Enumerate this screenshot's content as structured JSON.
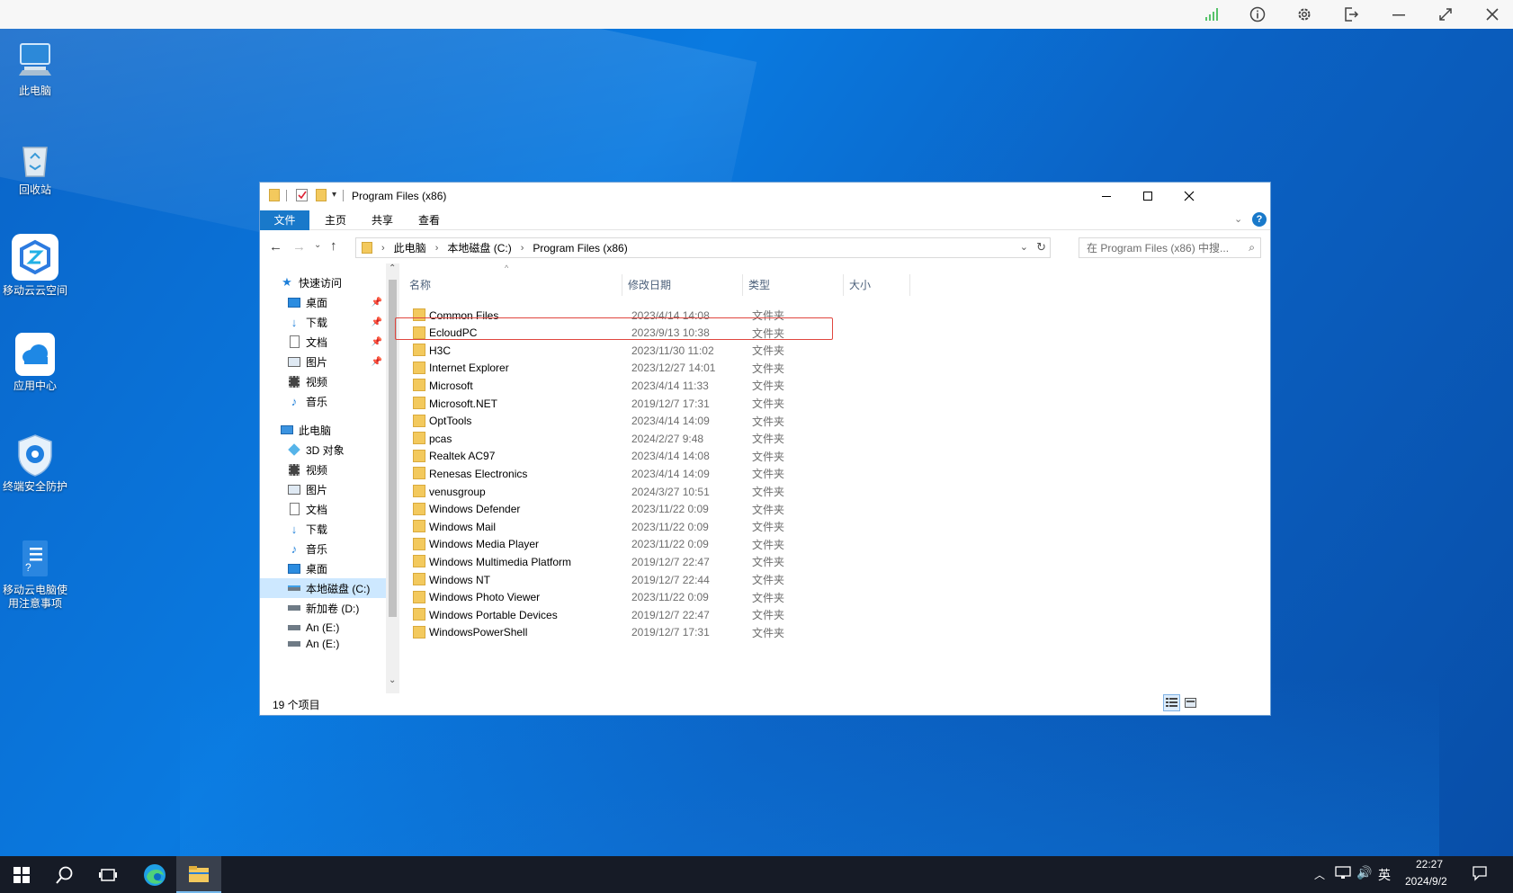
{
  "client_bar": {
    "icons": [
      "signal-icon",
      "info-icon",
      "settings-icon",
      "logout-icon",
      "minimize-icon",
      "fullscreen-icon",
      "close-icon"
    ]
  },
  "desktop": {
    "icons": [
      {
        "label": "此电脑",
        "icon": "computer-icon"
      },
      {
        "label": "回收站",
        "icon": "recycle-bin-icon"
      },
      {
        "label": "移动云云空间",
        "icon": "cloud-space-icon"
      },
      {
        "label": "应用中心",
        "icon": "app-center-icon"
      },
      {
        "label": "终端安全防护",
        "icon": "security-icon"
      },
      {
        "label": "移动云电脑使用注意事项",
        "icon": "document-icon"
      }
    ]
  },
  "window": {
    "title": "Program Files (x86)",
    "tabs": [
      "文件",
      "主页",
      "共享",
      "查看"
    ],
    "active_tab": "文件",
    "breadcrumb": [
      "此电脑",
      "本地磁盘 (C:)",
      "Program Files (x86)"
    ],
    "search_placeholder": "在 Program Files (x86) 中搜...",
    "nav": {
      "quick_access": "快速访问",
      "quick_items": [
        "桌面",
        "下载",
        "文档",
        "图片",
        "视频",
        "音乐"
      ],
      "this_pc": "此电脑",
      "pc_items": [
        "3D 对象",
        "视频",
        "图片",
        "文档",
        "下载",
        "音乐",
        "桌面",
        "本地磁盘 (C:)",
        "新加卷 (D:)",
        "An (E:)",
        "An (E:)"
      ]
    },
    "columns": [
      "名称",
      "修改日期",
      "类型",
      "大小"
    ],
    "files": [
      {
        "name": "Common Files",
        "date": "2023/4/14 14:08",
        "type": "文件夹"
      },
      {
        "name": "EcloudPC",
        "date": "2023/9/13 10:38",
        "type": "文件夹"
      },
      {
        "name": "H3C",
        "date": "2023/11/30 11:02",
        "type": "文件夹"
      },
      {
        "name": "Internet Explorer",
        "date": "2023/12/27 14:01",
        "type": "文件夹"
      },
      {
        "name": "Microsoft",
        "date": "2023/4/14 11:33",
        "type": "文件夹"
      },
      {
        "name": "Microsoft.NET",
        "date": "2019/12/7 17:31",
        "type": "文件夹"
      },
      {
        "name": "OptTools",
        "date": "2023/4/14 14:09",
        "type": "文件夹"
      },
      {
        "name": "pcas",
        "date": "2024/2/27 9:48",
        "type": "文件夹"
      },
      {
        "name": "Realtek AC97",
        "date": "2023/4/14 14:08",
        "type": "文件夹"
      },
      {
        "name": "Renesas Electronics",
        "date": "2023/4/14 14:09",
        "type": "文件夹"
      },
      {
        "name": "venusgroup",
        "date": "2024/3/27 10:51",
        "type": "文件夹"
      },
      {
        "name": "Windows Defender",
        "date": "2023/11/22 0:09",
        "type": "文件夹"
      },
      {
        "name": "Windows Mail",
        "date": "2023/11/22 0:09",
        "type": "文件夹"
      },
      {
        "name": "Windows Media Player",
        "date": "2023/11/22 0:09",
        "type": "文件夹"
      },
      {
        "name": "Windows Multimedia Platform",
        "date": "2019/12/7 22:47",
        "type": "文件夹"
      },
      {
        "name": "Windows NT",
        "date": "2019/12/7 22:44",
        "type": "文件夹"
      },
      {
        "name": "Windows Photo Viewer",
        "date": "2023/11/22 0:09",
        "type": "文件夹"
      },
      {
        "name": "Windows Portable Devices",
        "date": "2019/12/7 22:47",
        "type": "文件夹"
      },
      {
        "name": "WindowsPowerShell",
        "date": "2019/12/7 17:31",
        "type": "文件夹"
      }
    ],
    "highlighted_file": "H3C",
    "status": "19 个项目"
  },
  "taskbar": {
    "tray_lang": "英",
    "time": "22:27",
    "date": "2024/9/2"
  },
  "colors": {
    "highlight_box": "#e0463f",
    "active_tab": "#1979ca",
    "folder": "#f3c95d",
    "selected_nav": "#cde8ff"
  }
}
